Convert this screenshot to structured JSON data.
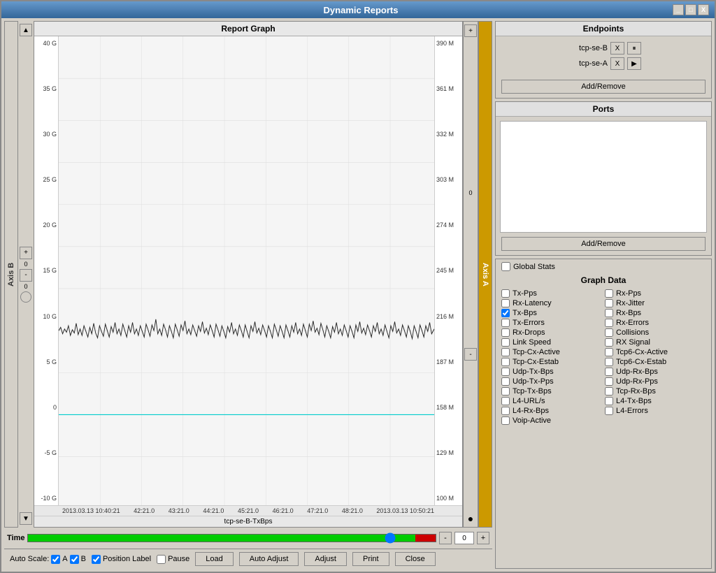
{
  "window": {
    "title": "Dynamic Reports",
    "minimize": "_",
    "maximize": "□",
    "close": "X"
  },
  "graph": {
    "title": "Report Graph",
    "y_axis_left": [
      "40 G",
      "35 G",
      "30 G",
      "25 G",
      "20 G",
      "15 G",
      "10 G",
      "5 G",
      "0",
      "-5 G",
      "-10 G"
    ],
    "y_axis_right": [
      "390 M",
      "361 M",
      "332 M",
      "303 M",
      "274 M",
      "245 M",
      "216 M",
      "187 M",
      "158 M",
      "129 M",
      "100 M"
    ],
    "x_axis": [
      "2013.03.13 10:40:21",
      "42:21.0",
      "43:21.0",
      "44:21.0",
      "45:21.0",
      "46:21.0",
      "47:21.0",
      "48:21.0",
      "2013.03.13 10:50:21"
    ],
    "x_label": "tcp-se-B-TxBps",
    "axis_b_label": "Axis B",
    "axis_a_label": "Axis A"
  },
  "endpoints": {
    "title": "Endpoints",
    "items": [
      {
        "label": "tcp-se-B",
        "x": "X",
        "pause": "⏸"
      },
      {
        "label": "tcp-se-A",
        "x": "X",
        "play": "▶"
      }
    ],
    "add_remove": "Add/Remove"
  },
  "ports": {
    "title": "Ports",
    "add_remove": "Add/Remove"
  },
  "global_stats": {
    "label": "Global Stats"
  },
  "graph_data": {
    "title": "Graph Data",
    "items_left": [
      {
        "label": "Tx-Pps",
        "checked": false
      },
      {
        "label": "Rx-Latency",
        "checked": false
      },
      {
        "label": "Tx-Bps",
        "checked": true
      },
      {
        "label": "Tx-Errors",
        "checked": false
      },
      {
        "label": "Rx-Drops",
        "checked": false
      },
      {
        "label": "Link Speed",
        "checked": false
      },
      {
        "label": "Tcp-Cx-Active",
        "checked": false
      },
      {
        "label": "Tcp-Cx-Estab",
        "checked": false
      },
      {
        "label": "Udp-Tx-Bps",
        "checked": false
      },
      {
        "label": "Udp-Tx-Pps",
        "checked": false
      },
      {
        "label": "Tcp-Tx-Bps",
        "checked": false
      },
      {
        "label": "L4-URL/s",
        "checked": false
      },
      {
        "label": "L4-Rx-Bps",
        "checked": false
      },
      {
        "label": "Voip-Active",
        "checked": false
      }
    ],
    "items_right": [
      {
        "label": "Rx-Pps",
        "checked": false
      },
      {
        "label": "Rx-Jitter",
        "checked": false
      },
      {
        "label": "Rx-Bps",
        "checked": false
      },
      {
        "label": "Rx-Errors",
        "checked": false
      },
      {
        "label": "Collisions",
        "checked": false
      },
      {
        "label": "RX Signal",
        "checked": false
      },
      {
        "label": "Tcp6-Cx-Active",
        "checked": false
      },
      {
        "label": "Tcp6-Cx-Estab",
        "checked": false
      },
      {
        "label": "Udp-Rx-Bps",
        "checked": false
      },
      {
        "label": "Udp-Rx-Pps",
        "checked": false
      },
      {
        "label": "Tcp-Rx-Bps",
        "checked": false
      },
      {
        "label": "L4-Tx-Bps",
        "checked": false
      },
      {
        "label": "L4-Errors",
        "checked": false
      }
    ]
  },
  "footer": {
    "auto_scale_label": "Auto Scale:",
    "check_a": "A",
    "check_b": "B",
    "position_label_label": "Position Label",
    "pause_label": "Pause",
    "load": "Load",
    "auto_adjust": "Auto Adjust",
    "adjust": "Adjust",
    "print": "Print",
    "close": "Close"
  },
  "time": {
    "label": "Time",
    "value": 90,
    "minus": "-",
    "plus": "+",
    "num": "0"
  },
  "left_scroll": {
    "plus": "+",
    "num_top": "0",
    "minus": "-",
    "num_bottom": "0"
  },
  "right_scroll": {
    "plus": "+",
    "num": "0",
    "minus": "-",
    "dot": "●"
  }
}
